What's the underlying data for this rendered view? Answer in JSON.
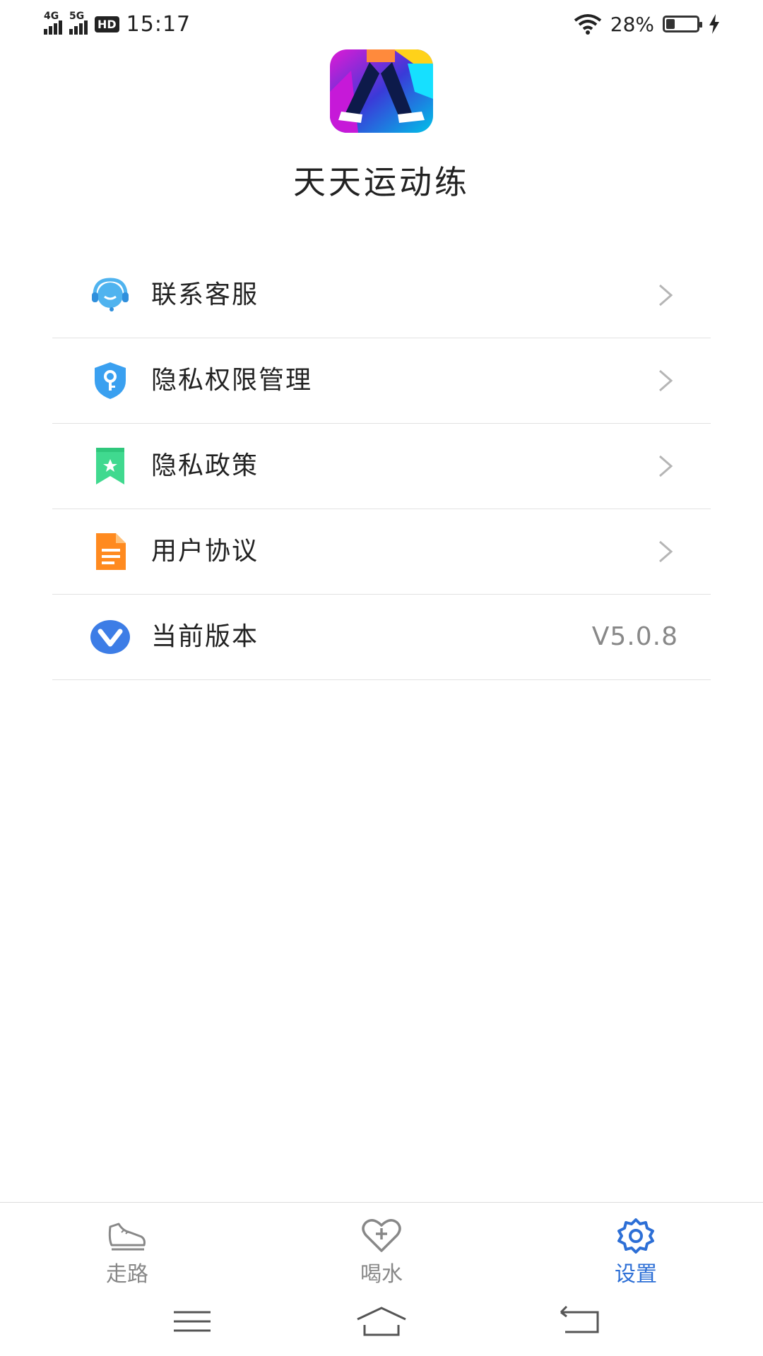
{
  "status_bar": {
    "signal_1": "4G",
    "signal_2": "5G",
    "hd": "HD",
    "time": "15:17",
    "battery_text": "28%",
    "battery_level": 0.28,
    "icons": [
      "signal-icon",
      "hd-icon",
      "wifi-icon",
      "battery-icon",
      "charging-icon"
    ]
  },
  "header": {
    "app_name": "天天运动练"
  },
  "menu": {
    "items": [
      {
        "label": "联系客服",
        "icon": "customer-service-icon"
      },
      {
        "label": "隐私权限管理",
        "icon": "privacy-shield-icon"
      },
      {
        "label": "隐私政策",
        "icon": "policy-bookmark-icon"
      },
      {
        "label": "用户协议",
        "icon": "agreement-document-icon"
      },
      {
        "label": "当前版本",
        "icon": "version-icon",
        "value": "V5.0.8"
      }
    ]
  },
  "tab_bar": {
    "tabs": [
      {
        "label": "走路",
        "icon": "shoe-icon",
        "active": false
      },
      {
        "label": "喝水",
        "icon": "heart-plus-icon",
        "active": false
      },
      {
        "label": "设置",
        "icon": "gear-icon",
        "active": true
      }
    ]
  },
  "colors": {
    "accent": "#2d6fd6",
    "inactive": "#888888",
    "divider": "#e2e2e2"
  }
}
